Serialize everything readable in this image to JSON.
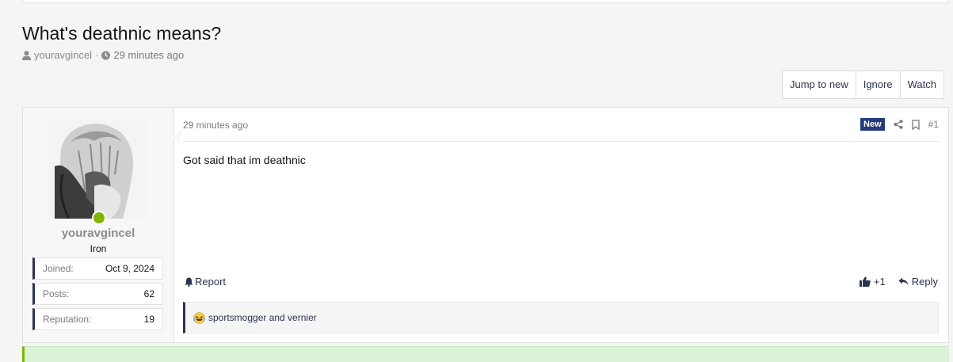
{
  "thread": {
    "title": "What's deathnic means?",
    "author": "youravgincel",
    "separator": "·",
    "time": "29 minutes ago"
  },
  "thread_buttons": {
    "jump_to_new": "Jump to new",
    "ignore": "Ignore",
    "watch": "Watch"
  },
  "post": {
    "date": "29 minutes ago",
    "badge": "New",
    "number": "#1",
    "body": "Got said that im deathnic",
    "report_label": "Report",
    "reaction_count": "+1",
    "reply_label": "Reply",
    "reactions_text": "sportsmogger and vernier"
  },
  "user": {
    "name": "youravgincel",
    "rank": "Iron",
    "stats": [
      {
        "label": "Joined:",
        "value": "Oct 9, 2024"
      },
      {
        "label": "Posts:",
        "value": "62"
      },
      {
        "label": "Reputation:",
        "value": "19"
      }
    ]
  },
  "colors": {
    "accent": "#2b3350",
    "badge_bg": "#253b7a",
    "online": "#7fb500",
    "username": "#8c8c8c"
  },
  "icons": {
    "author": "user-icon",
    "time": "clock-icon",
    "share": "share-icon",
    "bookmark": "bookmark-icon",
    "report": "bell-icon",
    "like": "thumbs-up-icon",
    "reply": "reply-icon",
    "reaction": "laughing-emoji-icon"
  }
}
